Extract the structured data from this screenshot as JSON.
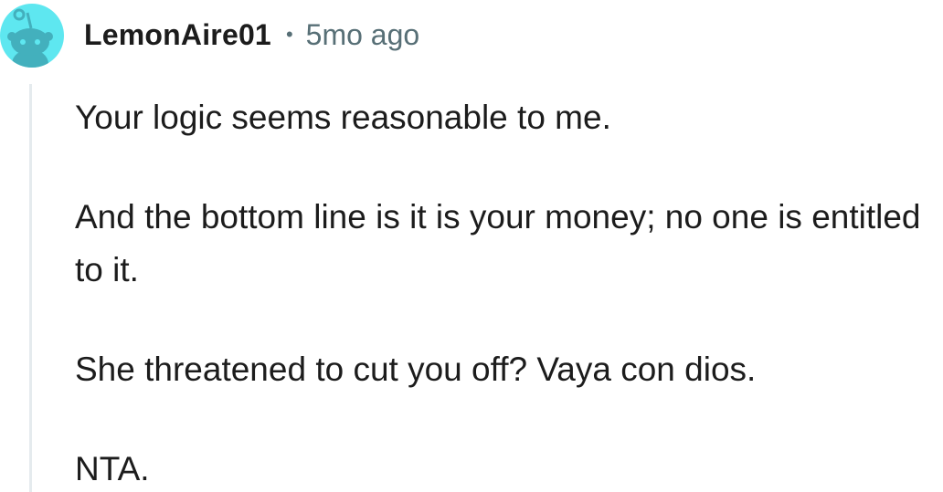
{
  "comment": {
    "author": "LemonAire01",
    "separator": "•",
    "timestamp": "5mo ago",
    "avatar_icon": "reddit-snoo-avatar-icon",
    "colors": {
      "avatar_bg": "#5ee7f0",
      "avatar_figure": "#43b0bd",
      "meta_text": "#576f76",
      "thread_line": "#e5ebee"
    },
    "paragraphs": [
      "Your logic seems reasonable to me.",
      "And the bottom line is it is your money; no one is entitled to it.",
      "She threatened to cut you off? Vaya con dios.",
      "NTA."
    ]
  }
}
